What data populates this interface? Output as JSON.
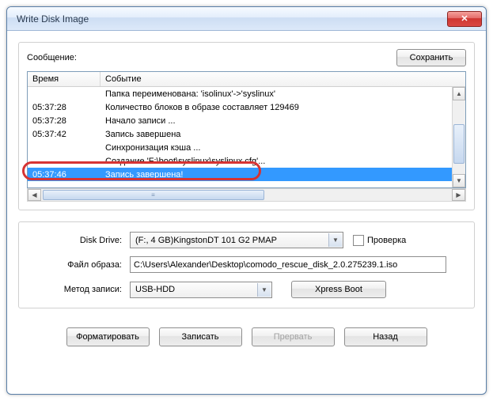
{
  "window": {
    "title": "Write Disk Image"
  },
  "group1": {
    "message_label": "Сообщение:",
    "save_label": "Сохранить",
    "columns": {
      "time": "Время",
      "event": "Событие"
    },
    "rows": [
      {
        "time": "",
        "event": "Папка переименована: 'isolinux'->'syslinux'"
      },
      {
        "time": "05:37:28",
        "event": "Количество блоков в образе составляет 129469"
      },
      {
        "time": "05:37:28",
        "event": "Начало записи ..."
      },
      {
        "time": "05:37:42",
        "event": "Запись завершена"
      },
      {
        "time": "",
        "event": "Синхронизация кэша ..."
      },
      {
        "time": "",
        "event": "Создание 'F:\\boot\\syslinux\\syslinux.cfg'..."
      },
      {
        "time": "05:37:46",
        "event": "Запись завершена!"
      }
    ]
  },
  "group2": {
    "disk_drive_label": "Disk Drive:",
    "disk_drive_value": "(F:, 4 GB)KingstonDT 101 G2    PMAP",
    "verify_label": "Проверка",
    "image_file_label": "Файл образа:",
    "image_file_value": "C:\\Users\\Alexander\\Desktop\\comodo_rescue_disk_2.0.275239.1.iso",
    "write_method_label": "Метод записи:",
    "write_method_value": "USB-HDD",
    "xpress_label": "Xpress Boot"
  },
  "buttons": {
    "format": "Форматировать",
    "write": "Записать",
    "abort": "Прервать",
    "back": "Назад"
  }
}
